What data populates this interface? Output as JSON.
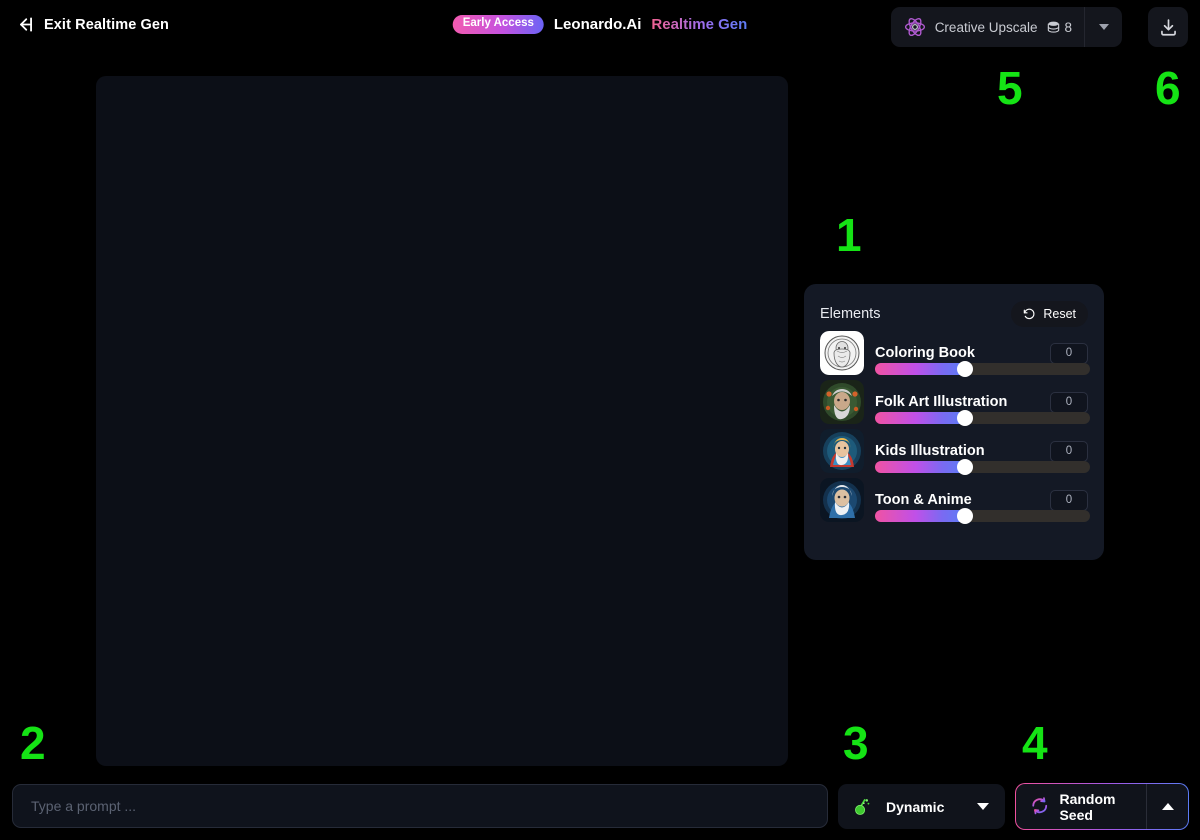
{
  "header": {
    "exit_label": "Exit Realtime Gen",
    "exit_icon": "arrow-left-to-bar-icon",
    "badge": "Early Access",
    "brand_name": "Leonardo.Ai",
    "brand_sub": "Realtime Gen",
    "upscale_label": "Creative Upscale",
    "upscale_icon": "atom-icon",
    "token_icon": "coin-stack-icon",
    "token_count": "8",
    "caret_icon": "chevron-down-icon",
    "download_icon": "download-icon"
  },
  "panel": {
    "title": "Elements",
    "reset_label": "Reset",
    "reset_icon": "undo-arrow-icon",
    "items": [
      {
        "name": "Coloring Book",
        "value": "0",
        "slider_pct": 42,
        "thumb": "coloring-book-thumbnail"
      },
      {
        "name": "Folk Art Illustration",
        "value": "0",
        "slider_pct": 42,
        "thumb": "folk-art-thumbnail"
      },
      {
        "name": "Kids Illustration",
        "value": "0",
        "slider_pct": 42,
        "thumb": "kids-illustration-thumbnail"
      },
      {
        "name": "Toon & Anime",
        "value": "0",
        "slider_pct": 42,
        "thumb": "toon-anime-thumbnail"
      }
    ]
  },
  "bottom": {
    "prompt_placeholder": "Type a prompt ...",
    "prompt_value": "",
    "dynamic_label": "Dynamic",
    "dynamic_icon": "potion-flask-icon",
    "dynamic_caret": "chevron-down-icon",
    "seed_label": "Random Seed",
    "seed_icon": "refresh-icon",
    "seed_caret": "chevron-up-icon"
  },
  "annotations": {
    "color": "#15e315",
    "n1": "1",
    "n2": "2",
    "n3": "3",
    "n4": "4",
    "n5": "5",
    "n6": "6"
  }
}
